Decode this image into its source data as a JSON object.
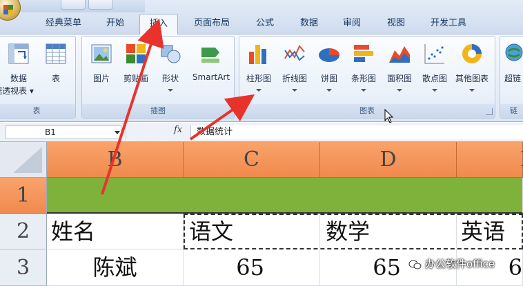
{
  "tabs": [
    {
      "label": "经典菜单",
      "active": false
    },
    {
      "label": "开始",
      "active": false
    },
    {
      "label": "插入",
      "active": true
    },
    {
      "label": "页面布局",
      "active": false
    },
    {
      "label": "公式",
      "active": false
    },
    {
      "label": "数据",
      "active": false
    },
    {
      "label": "审阅",
      "active": false
    },
    {
      "label": "视图",
      "active": false
    },
    {
      "label": "开发工具",
      "active": false
    }
  ],
  "groups": {
    "table": {
      "label": "表",
      "buttons": [
        {
          "line1": "数据",
          "line2": "据透视表 ▾",
          "icon": "pivot-table-icon"
        },
        {
          "line1": "表",
          "icon": "table-icon"
        }
      ]
    },
    "illustrations": {
      "label": "插图",
      "buttons": [
        {
          "label": "图片",
          "icon": "picture-icon"
        },
        {
          "label": "剪贴画",
          "icon": "clip-art-icon"
        },
        {
          "label": "形状",
          "icon": "shapes-icon"
        },
        {
          "label": "SmartArt",
          "icon": "smartart-icon"
        }
      ]
    },
    "charts": {
      "label": "图表",
      "buttons": [
        {
          "label": "柱形图",
          "icon": "column-chart-icon"
        },
        {
          "label": "折线图",
          "icon": "line-chart-icon"
        },
        {
          "label": "饼图",
          "icon": "pie-chart-icon"
        },
        {
          "label": "条形图",
          "icon": "bar-chart-icon"
        },
        {
          "label": "面积图",
          "icon": "area-chart-icon"
        },
        {
          "label": "散点图",
          "icon": "scatter-chart-icon"
        },
        {
          "label": "其他图表",
          "icon": "other-charts-icon"
        }
      ]
    },
    "links": {
      "label": "链",
      "buttons": [
        {
          "label": "超链",
          "icon": "hyperlink-icon"
        }
      ]
    }
  },
  "formula_bar": {
    "name_box": "B1",
    "fx": "fx",
    "content": "数据统计"
  },
  "sheet": {
    "columns": [
      "B",
      "C",
      "D",
      "E"
    ],
    "rows": [
      "1",
      "2",
      "3"
    ],
    "cells": {
      "B2": "姓名",
      "C2": "语文",
      "D2": "数学",
      "E2": "英语",
      "B3": "陈斌",
      "C3": "65",
      "D3": "65",
      "E3": "6"
    }
  },
  "colors": {
    "header_orange": "#f08a4d",
    "merged_green": "#7fb23a",
    "arrow_red": "#e8332d"
  },
  "watermark": "办公软件office"
}
